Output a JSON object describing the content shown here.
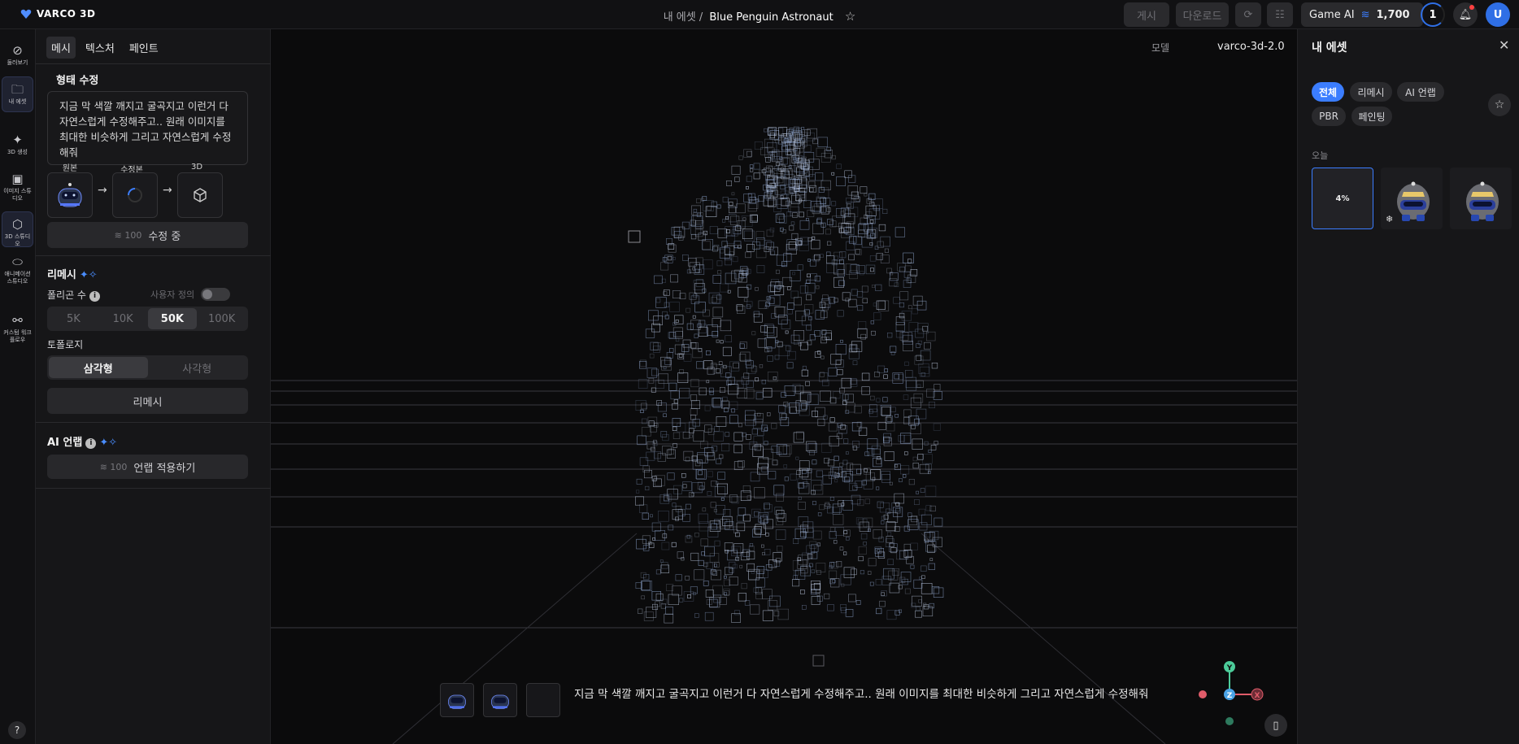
{
  "app": {
    "brand": "VARCO 3D"
  },
  "header": {
    "breadcrumb_parent": "내 에셋 /",
    "asset_title": "Blue Penguin Astronaut",
    "publish_label": "게시",
    "download_label": "다운로드",
    "plan_name": "Game AI",
    "credits": "1,700",
    "notification_count": "1",
    "avatar_letter": "U"
  },
  "rail": {
    "items": [
      {
        "label": "둘러보기",
        "icon": "compass-icon"
      },
      {
        "label": "내 에셋",
        "icon": "folder-icon"
      },
      {
        "label": "3D 생성",
        "icon": "sparkle-icon"
      },
      {
        "label": "이미지 스튜디오",
        "icon": "image-icon"
      },
      {
        "label": "3D 스튜디오",
        "icon": "cube-icon"
      },
      {
        "label": "애니메이션 스튜디오",
        "icon": "pill-icon"
      },
      {
        "label": "커스텀 워크플로우",
        "icon": "workflow-icon"
      }
    ],
    "help_label": "?"
  },
  "panel": {
    "tabs": [
      "메시",
      "텍스처",
      "페인트"
    ],
    "shape_edit": {
      "title": "형태 수정",
      "prompt": "지금 막 색깔 깨지고 굴곡지고 이런거 다 자연스럽게 수정해주고.. 원래 이미지를 최대한 비슷하게 그리고 자연스럽게 수정해줘",
      "original_label": "원본",
      "edited_label": "수정본",
      "result_label": "3D",
      "cost": "100",
      "status_button": "수정 중"
    },
    "remesh": {
      "title": "리메시",
      "polygon_label": "폴리곤 수",
      "custom_label": "사용자 정의",
      "polygon_options": [
        "5K",
        "10K",
        "50K",
        "100K"
      ],
      "polygon_selected": "50K",
      "topology_label": "토폴로지",
      "topology_options": [
        "삼각형",
        "사각형"
      ],
      "topology_selected": "삼각형",
      "button": "리메시"
    },
    "unwrap": {
      "title": "AI 언랩",
      "cost": "100",
      "button": "언랩 적용하기"
    }
  },
  "viewport": {
    "model_label": "모델",
    "model_value": "varco-3d-2.0",
    "bottom_prompt": "지금 막 색깔 깨지고 굴곡지고 이런거 다 자연스럽게 수정해주고.. 원래 이미지를 최대한 비슷하게 그리고 자연스럽게 수정해줘",
    "gizmo": {
      "y": "Y",
      "z": "Z",
      "x": "X"
    }
  },
  "right_panel": {
    "title": "내 에셋",
    "filters": [
      "전체",
      "리메시",
      "AI 언랩",
      "PBR",
      "페인팅"
    ],
    "filter_selected": "전체",
    "section_today": "오늘",
    "generating_progress": "4%"
  },
  "colors": {
    "accent": "#3b7dff",
    "bg": "#0f0f10",
    "panel": "#161618"
  }
}
